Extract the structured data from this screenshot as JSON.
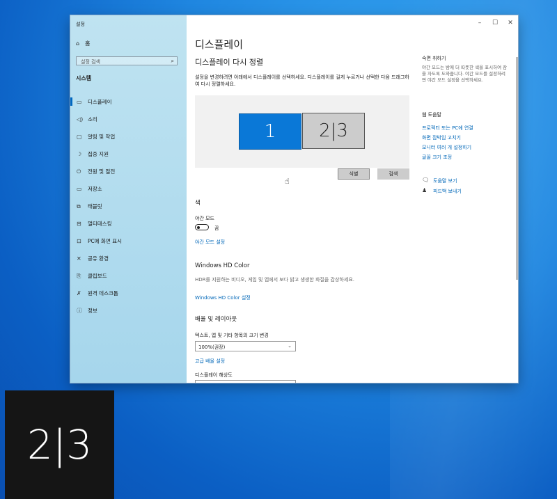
{
  "window": {
    "title": "설정",
    "controls": [
      "–",
      "☐",
      "✕"
    ]
  },
  "sidebar": {
    "home": "홈",
    "search_placeholder": "설정 검색",
    "section": "시스템",
    "items": [
      {
        "label": "디스플레이",
        "icon": "monitor-icon",
        "active": true
      },
      {
        "label": "소리",
        "icon": "speaker-icon"
      },
      {
        "label": "알림 및 작업",
        "icon": "notification-icon"
      },
      {
        "label": "집중 지원",
        "icon": "moon-icon"
      },
      {
        "label": "전원 및 절전",
        "icon": "power-icon"
      },
      {
        "label": "저장소",
        "icon": "storage-icon"
      },
      {
        "label": "태블릿",
        "icon": "tablet-icon"
      },
      {
        "label": "멀티태스킹",
        "icon": "multitask-icon"
      },
      {
        "label": "PC에 화면 표시",
        "icon": "project-icon"
      },
      {
        "label": "공유 환경",
        "icon": "share-icon"
      },
      {
        "label": "클립보드",
        "icon": "clipboard-icon"
      },
      {
        "label": "원격 데스크톱",
        "icon": "remote-icon"
      },
      {
        "label": "정보",
        "icon": "info-icon"
      }
    ]
  },
  "main": {
    "title": "디스플레이",
    "rearrange_heading": "디스플레이 다시 정렬",
    "rearrange_desc": "설정을 변경하려면 아래에서 디스플레이를 선택하세요. 디스플레이를 길게 누르거나 선택한 다음 드래그하여 다시 정렬하세요.",
    "monitor1_label": "1",
    "monitor2_label": "2|3",
    "identify_button": "식별",
    "detect_button": "검색",
    "color_heading": "색",
    "night_mode_label": "야간 모드",
    "night_mode_state": "끔",
    "night_mode_settings_link": "야간 모드 설정",
    "hd_color_heading": "Windows HD Color",
    "hd_color_desc": "HDR를 지원하는 비디오, 게임 및 앱에서 보다 밝고 생생한 화질을 감상하세요.",
    "hd_color_link": "Windows HD Color 설정",
    "scale_heading": "배율 및 레이아웃",
    "scale_label": "텍스트, 앱 및 기타 항목의 크기 변경",
    "scale_value": "100%(권장)",
    "advanced_scale_link": "고급 배율 설정",
    "resolution_label": "디스플레이 해상도"
  },
  "right_panel": {
    "sleep_title": "숙면 취하기",
    "sleep_desc": "야간 모드는 밤에 더 따뜻한 색을 표시하여 잠을 자도록 도와줍니다. 야간 모드를 설정하려면 야간 모드 설정을 선택하세요.",
    "help_title": "웹 도움말",
    "help_links": [
      "프로젝터 또는 PC에 연결",
      "화면 깜박임 고치기",
      "모니터 여러 개 설정하기",
      "글꼴 크기 조정"
    ],
    "get_help": "도움말 보기",
    "feedback": "피드백 보내기"
  },
  "identify_overlay": "2|3"
}
